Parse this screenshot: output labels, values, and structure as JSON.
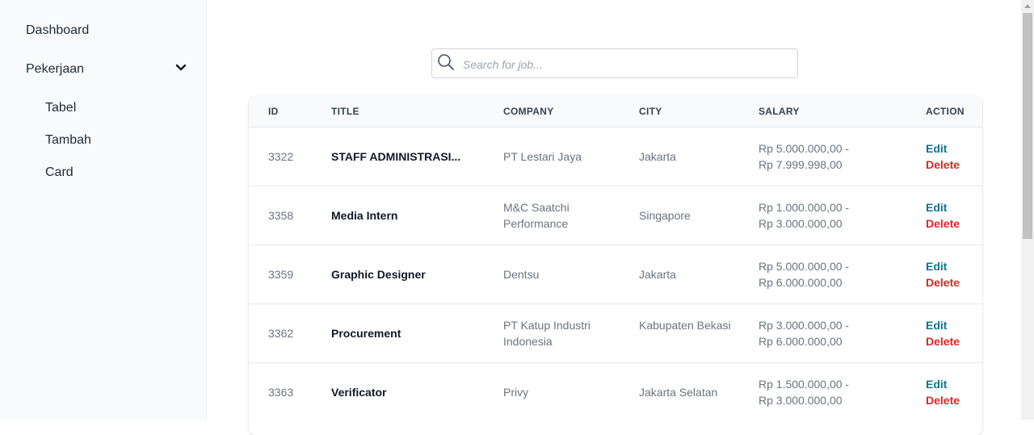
{
  "sidebar": {
    "dashboard": "Dashboard",
    "pekerjaan": "Pekerjaan",
    "sub_items": [
      "Tabel",
      "Tambah",
      "Card"
    ]
  },
  "search": {
    "placeholder": "Search for job..."
  },
  "table": {
    "headers": [
      "ID",
      "TITLE",
      "COMPANY",
      "CITY",
      "SALARY",
      "ACTION"
    ],
    "rows": [
      {
        "id": "3322",
        "title": "STAFF ADMINISTRASI...",
        "company": "PT Lestari Jaya",
        "city": "Jakarta",
        "salary_min": "Rp 5.000.000,00 -",
        "salary_max": "Rp 7.999.998,00"
      },
      {
        "id": "3358",
        "title": "Media Intern",
        "company": "M&C Saatchi Performance",
        "city": "Singapore",
        "salary_min": "Rp 1.000.000,00 -",
        "salary_max": "Rp 3.000.000,00"
      },
      {
        "id": "3359",
        "title": "Graphic Designer",
        "company": "Dentsu",
        "city": "Jakarta",
        "salary_min": "Rp 5.000.000,00 -",
        "salary_max": "Rp 6.000.000,00"
      },
      {
        "id": "3362",
        "title": "Procurement",
        "company": "PT Katup Industri Indonesia",
        "city": "Kabupaten Bekasi",
        "salary_min": "Rp 3.000.000,00 -",
        "salary_max": "Rp 6.000.000,00"
      },
      {
        "id": "3363",
        "title": "Verificator",
        "company": "Privy",
        "city": "Jakarta Selatan",
        "salary_min": "Rp 1.500.000,00 -",
        "salary_max": "Rp 3.000.000,00"
      }
    ],
    "edit_label": "Edit",
    "delete_label": "Delete"
  },
  "colors": {
    "edit": "#0e7490",
    "delete": "#dc2626",
    "sidebar_bg": "#f9fafb"
  }
}
